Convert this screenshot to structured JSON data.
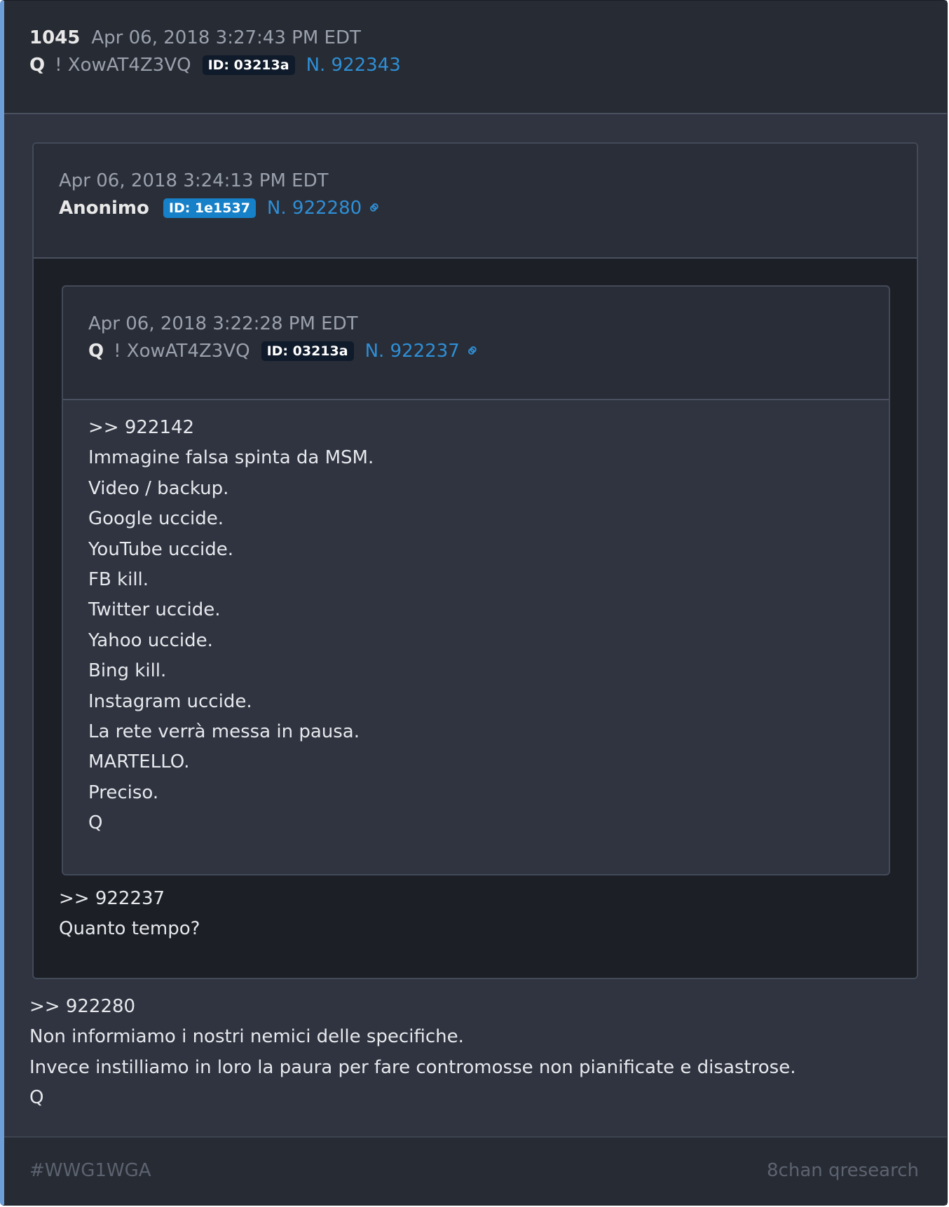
{
  "post": {
    "number": "1045",
    "timestamp": "Apr 06, 2018 3:27:43 PM EDT",
    "author": "Q",
    "tripcode": "! XowAT4Z3VQ",
    "id_badge": "ID: 03213a",
    "post_no": "N. 922343",
    "body": [
      ">> 922280",
      "Non informiamo i nostri nemici delle specifiche.",
      "Invece instilliamo in loro la paura per fare contromosse non pianificate e disastrose.",
      "Q"
    ]
  },
  "quote_outer": {
    "timestamp": "Apr 06, 2018 3:24:13 PM EDT",
    "author": "Anonimo",
    "id_badge": "ID: 1e1537",
    "post_no": "N. 922280",
    "body": [
      ">> 922237",
      "Quanto tempo?"
    ]
  },
  "quote_inner": {
    "timestamp": "Apr 06, 2018 3:22:28 PM EDT",
    "author": "Q",
    "tripcode": "! XowAT4Z3VQ",
    "id_badge": "ID: 03213a",
    "post_no": "N. 922237",
    "body": [
      ">> 922142",
      "Immagine falsa spinta da MSM.",
      "Video / backup.",
      "Google uccide.",
      "YouTube uccide.",
      "FB kill.",
      "Twitter uccide.",
      "Yahoo uccide.",
      "Bing kill.",
      "Instagram uccide.",
      "La rete verrà messa in pausa.",
      "MARTELLO.",
      "Preciso.",
      "Q"
    ]
  },
  "footer": {
    "hashtag": "#WWG1WGA",
    "board": "8chan qresearch"
  },
  "colors": {
    "accent_border": "#6f9fd8",
    "link": "#2e8fd6",
    "badge_dark": "#0f1a2a",
    "badge_blue": "#1680c8"
  },
  "icons": {
    "link": "chain-link-icon"
  }
}
